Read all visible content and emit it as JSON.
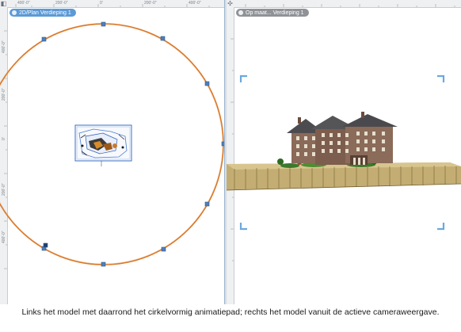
{
  "left_view": {
    "tab_label": "2D/Plan Verdieping 1",
    "ruler_top": [
      "400'-0\"",
      "200'-0\"",
      "0'",
      "200'-0\"",
      "400'-0\""
    ],
    "ruler_left": [
      "400'-0\"",
      "200'-0\"",
      "0'",
      "200'-0\"",
      "400'-0\""
    ]
  },
  "right_view": {
    "tab_label": "Op maat... Verdieping 1",
    "ruler_top": [
      "",
      "",
      "",
      "",
      "",
      "",
      ""
    ],
    "ruler_left": [
      "",
      "",
      "",
      ""
    ]
  },
  "caption": "Links het model met daarrond het cirkelvormig animatiepad; rechts het model vanuit de actieve cameraweergave.",
  "colors": {
    "path_orange": "#d9782a",
    "path_point": "#4e7fb8",
    "tab_active": "#5c9ad6",
    "tab_inactive": "#8f9398",
    "camera_corner": "#6aa9e0",
    "ground": "#c4ad73"
  },
  "icons": [
    "view-options-icon",
    "pin-icon",
    "camera-corner-icon"
  ]
}
